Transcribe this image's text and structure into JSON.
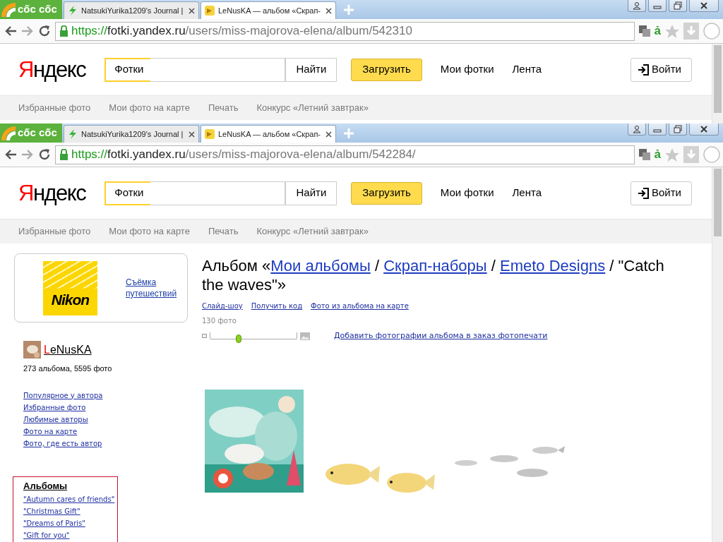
{
  "windows": [
    {
      "tabs": [
        {
          "kind": "logo",
          "label": "cốc cốc"
        },
        {
          "kind": "page",
          "label": "NatsukiYurika1209's Journal |",
          "selected": false
        },
        {
          "kind": "page",
          "label": "LeNusKA — альбом «Скрап-",
          "selected": true
        }
      ],
      "url": {
        "scheme": "https://",
        "host": "fotki.yandex.ru",
        "path": "/users/miss-majorova-elena/album/542310"
      },
      "extension_glyph": "ả",
      "header": {
        "logo_first": "Я",
        "logo_rest": "ндекс",
        "service_tag": "Фотки",
        "search_button": "Найти",
        "upload_button": "Загрузить",
        "links": [
          "Мои фотки",
          "Лента"
        ],
        "login_button": "Войти"
      },
      "subnav": [
        "Избранные фото",
        "Мои фото на карте",
        "Печать",
        "Конкурс «Летний завтрак»"
      ]
    },
    {
      "tabs": [
        {
          "kind": "logo",
          "label": "cốc cốc"
        },
        {
          "kind": "page",
          "label": "NatsukiYurika1209's Journal |",
          "selected": false
        },
        {
          "kind": "page",
          "label": "LeNusKA — альбом «Скрап-",
          "selected": true
        }
      ],
      "url": {
        "scheme": "https://",
        "host": "fotki.yandex.ru",
        "path": "/users/miss-majorova-elena/album/542284/"
      },
      "extension_glyph": "ả",
      "header": {
        "logo_first": "Я",
        "logo_rest": "ндекс",
        "service_tag": "Фотки",
        "search_button": "Найти",
        "upload_button": "Загрузить",
        "links": [
          "Мои фотки",
          "Лента"
        ],
        "login_button": "Войти"
      },
      "subnav": [
        "Избранные фото",
        "Мои фото на карте",
        "Печать",
        "Конкурс «Летний завтрак»"
      ],
      "page": {
        "sidebar": {
          "ad": {
            "brand": "Nikon",
            "link": "Съёмка путешествий"
          },
          "user": {
            "initial": "L",
            "rest": "eNusKA",
            "stats": "273 альбома, 5595 фото"
          },
          "links": [
            "Популярное у автора",
            "Избранные фото",
            "Любимые авторы",
            "Фото на карте",
            "Фото, где есть автор"
          ],
          "albums": {
            "title": "Альбомы",
            "items": [
              "\"Autumn cares of friends\"",
              "\"Christmas Gift\"",
              "\"Dreams of Paris\"",
              "\"Gift for you\""
            ]
          }
        },
        "album": {
          "title_parts": [
            {
              "kind": "text",
              "text": "Альбом «"
            },
            {
              "kind": "link",
              "text": "Мои альбомы"
            },
            {
              "kind": "text",
              "text": " / "
            },
            {
              "kind": "link",
              "text": "Скрап-наборы"
            },
            {
              "kind": "text",
              "text": " / "
            },
            {
              "kind": "link",
              "text": "Emeto Designs"
            },
            {
              "kind": "text",
              "text": " / \"Catch the waves\"»"
            }
          ],
          "actions": [
            "Слайд-шоу",
            "Получить код",
            "Фото из альбома на карте"
          ],
          "count": "130 фото",
          "zoom": {
            "level": 0.33
          },
          "print_link": "Добавить фотографии альбома в заказ фотопечати",
          "photos": [
            {
              "kind": "picture"
            },
            {
              "kind": "picture"
            },
            {
              "kind": "picture"
            }
          ]
        }
      }
    }
  ]
}
